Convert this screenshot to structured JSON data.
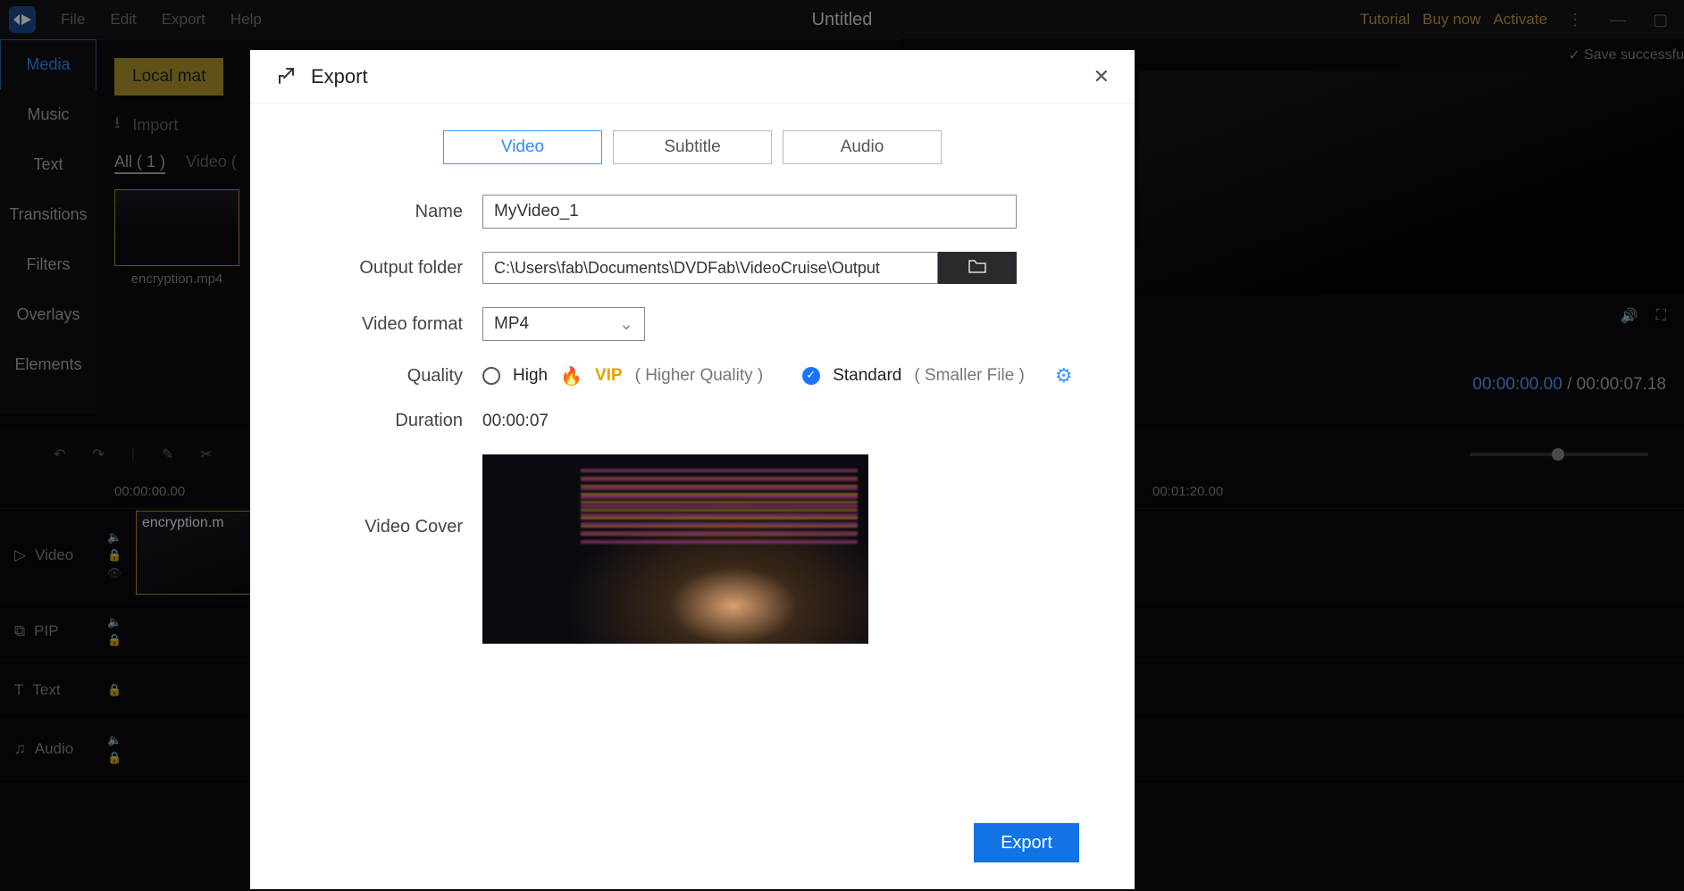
{
  "app": {
    "title": "Untitled",
    "menu": [
      "File",
      "Edit",
      "Export",
      "Help"
    ],
    "right_links": {
      "tutorial": "Tutorial",
      "buy": "Buy now",
      "activate": "Activate"
    },
    "save_status": "Save successfu"
  },
  "sidebar": {
    "items": [
      {
        "label": "Media",
        "active": true
      },
      {
        "label": "Music"
      },
      {
        "label": "Text"
      },
      {
        "label": "Transitions"
      },
      {
        "label": "Filters"
      },
      {
        "label": "Overlays"
      },
      {
        "label": "Elements"
      }
    ]
  },
  "media": {
    "local_mat": "Local mat",
    "import": "Import",
    "filter_all": "All ( 1 )",
    "filter_video": "Video (",
    "thumb_name": "encryption.mp4"
  },
  "preview": {
    "current_time": "00:00:00.00",
    "sep": "/",
    "total_time": "00:00:07.18"
  },
  "timeline": {
    "ticks": {
      "t0": "00:00:00.00",
      "t1": "00:01:20.00"
    },
    "tracks": {
      "video": "Video",
      "pip": "PIP",
      "text": "Text",
      "audio": "Audio"
    },
    "clip_label": "encryption.m"
  },
  "export_modal": {
    "title": "Export",
    "tabs": {
      "video": "Video",
      "subtitle": "Subtitle",
      "audio": "Audio"
    },
    "labels": {
      "name": "Name",
      "output_folder": "Output folder",
      "video_format": "Video format",
      "quality": "Quality",
      "duration": "Duration",
      "video_cover": "Video Cover"
    },
    "name_value": "MyVideo_1",
    "output_value": "C:\\Users\\fab\\Documents\\DVDFab\\VideoCruise\\Output",
    "format_value": "MP4",
    "quality": {
      "high_label": "High",
      "vip": "VIP",
      "high_hint": "( Higher Quality )",
      "standard_label": "Standard",
      "standard_hint": "( Smaller File )"
    },
    "duration_value": "00:00:07",
    "export_button": "Export"
  }
}
